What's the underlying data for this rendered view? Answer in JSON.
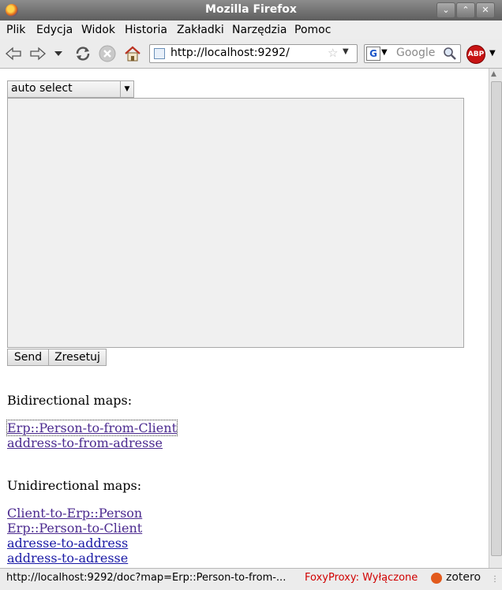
{
  "window": {
    "title": "Mozilla Firefox"
  },
  "menu": [
    "Plik",
    "Edycja",
    "Widok",
    "Historia",
    "Zakładki",
    "Narzędzia",
    "Pomoc"
  ],
  "toolbar": {
    "url": "http://localhost:9292/",
    "search_placeholder": "Google",
    "search_engine_letter": "G",
    "abp_label": "ABP"
  },
  "page": {
    "select_value": "auto select",
    "send_label": "Send",
    "reset_label": "Zresetuj",
    "bidirectional_heading": "Bidirectional maps:",
    "bidirectional_links": [
      "Erp::Person-to-from-Client",
      "address-to-from-adresse"
    ],
    "unidirectional_heading": "Unidirectional maps:",
    "unidirectional_links": [
      "Client-to-Erp::Person",
      "Erp::Person-to-Client",
      "adresse-to-address",
      "address-to-adresse"
    ]
  },
  "status": {
    "text": "http://localhost:9292/doc?map=Erp::Person-to-from-...",
    "foxyproxy": "FoxyProxy: Wyłączone",
    "zotero": "zotero"
  },
  "colors": {
    "link_visited": "#4b2a8f",
    "link_unvisited": "#1a1aa6",
    "foxyproxy": "#d10000"
  }
}
